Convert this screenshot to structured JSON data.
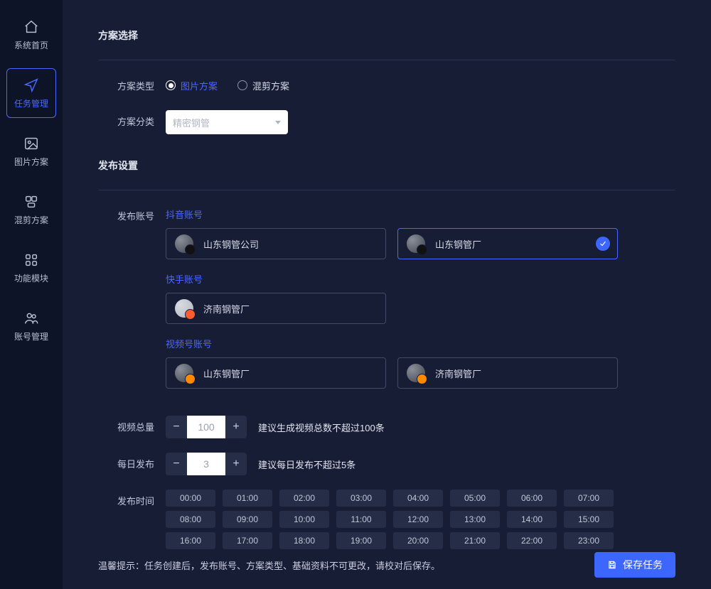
{
  "sidebar": {
    "items": [
      {
        "label": "系统首页",
        "icon": "home-icon"
      },
      {
        "label": "任务管理",
        "icon": "send-icon",
        "active": true
      },
      {
        "label": "图片方案",
        "icon": "image-icon"
      },
      {
        "label": "混剪方案",
        "icon": "tiles-icon"
      },
      {
        "label": "功能模块",
        "icon": "grid-icon"
      },
      {
        "label": "账号管理",
        "icon": "users-icon"
      }
    ]
  },
  "sections": {
    "plan_select": "方案选择",
    "publish_settings": "发布设置"
  },
  "form": {
    "plan_type": {
      "label": "方案类型",
      "options": [
        {
          "label": "图片方案",
          "checked": true
        },
        {
          "label": "混剪方案",
          "checked": false
        }
      ]
    },
    "plan_category": {
      "label": "方案分类",
      "selected": "精密钢管"
    },
    "publish_account": {
      "label": "发布账号",
      "groups": {
        "douyin": {
          "title": "抖音账号",
          "items": [
            {
              "name": "山东钢管公司",
              "selected": false
            },
            {
              "name": "山东钢管厂",
              "selected": true
            }
          ]
        },
        "kuaishou": {
          "title": "快手账号",
          "items": [
            {
              "name": "济南钢管厂",
              "selected": false
            }
          ]
        },
        "shipin": {
          "title": "视频号账号",
          "items": [
            {
              "name": "山东钢管厂",
              "selected": false
            },
            {
              "name": "济南钢管厂",
              "selected": false
            }
          ]
        }
      }
    },
    "video_total": {
      "label": "视频总量",
      "value": "100",
      "hint": "建议生成视频总数不超过100条"
    },
    "daily_publish": {
      "label": "每日发布",
      "value": "3",
      "hint": "建议每日发布不超过5条"
    },
    "publish_time": {
      "label": "发布时间",
      "slots": [
        "00:00",
        "01:00",
        "02:00",
        "03:00",
        "04:00",
        "05:00",
        "06:00",
        "07:00",
        "08:00",
        "09:00",
        "10:00",
        "11:00",
        "12:00",
        "13:00",
        "14:00",
        "15:00",
        "16:00",
        "17:00",
        "18:00",
        "19:00",
        "20:00",
        "21:00",
        "22:00",
        "23:00"
      ]
    }
  },
  "footer": {
    "tip": "温馨提示：任务创建后，发布账号、方案类型、基础资料不可更改，请校对后保存。",
    "save_label": "保存任务"
  }
}
